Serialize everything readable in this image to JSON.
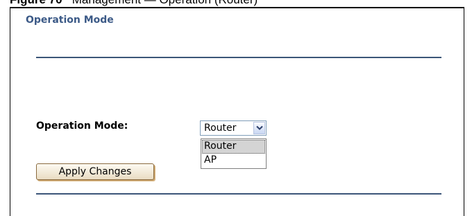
{
  "figure_caption": {
    "figure_label": "Figure 70",
    "title": "Management — Operation (Router)"
  },
  "section": {
    "title": "Operation Mode"
  },
  "form": {
    "operation_mode_label": "Operation Mode:",
    "operation_mode_select": {
      "selected": "Router",
      "options": [
        "Router",
        "AP"
      ],
      "highlighted_option": "Router"
    },
    "apply_button_label": "Apply Changes"
  },
  "colors": {
    "section_title": "#3c5a87",
    "rule": "#3b5578",
    "option_highlight": "#d4d4d4"
  },
  "icons": {
    "dropdown_arrow": "chevron-down-icon"
  }
}
